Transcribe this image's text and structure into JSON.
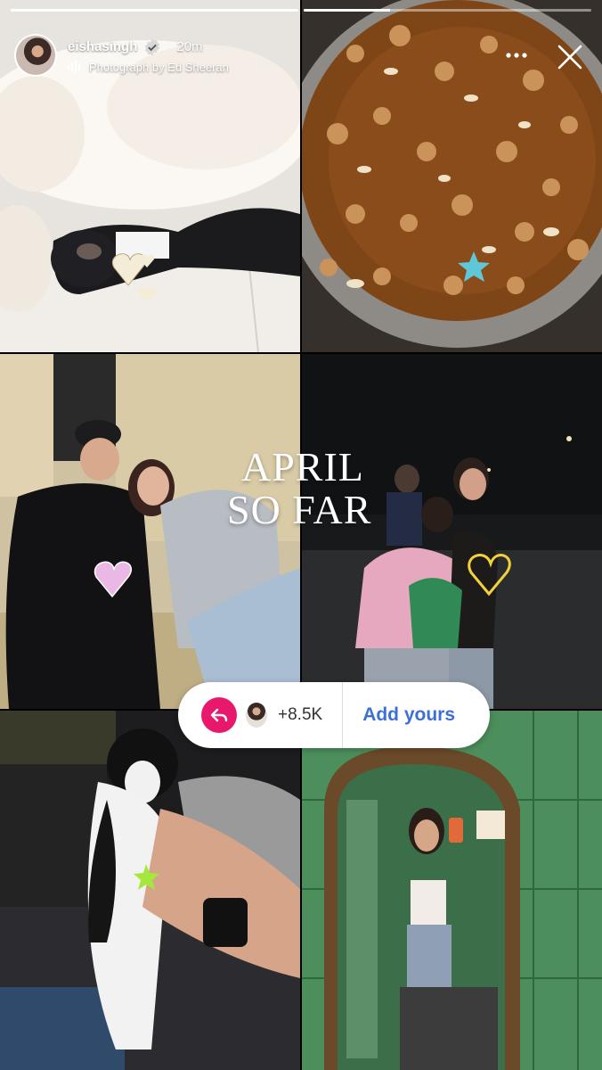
{
  "story": {
    "progress": [
      1,
      0.3
    ]
  },
  "header": {
    "username": "eishasingh",
    "verified_icon": "verified-badge-icon",
    "time": "20m",
    "music": "Photograph by Ed Sheeran"
  },
  "overlay": {
    "title_line1": "APRIL",
    "title_line2": "SO FAR"
  },
  "add_yours": {
    "count": "+8.5K",
    "label": "Add yours",
    "accent": "#e8196c",
    "label_color": "#3d6fd9"
  },
  "icons": {
    "menu": "more-icon",
    "close": "close-icon",
    "music": "music-bars-icon",
    "reply": "reply-arrow-icon"
  }
}
